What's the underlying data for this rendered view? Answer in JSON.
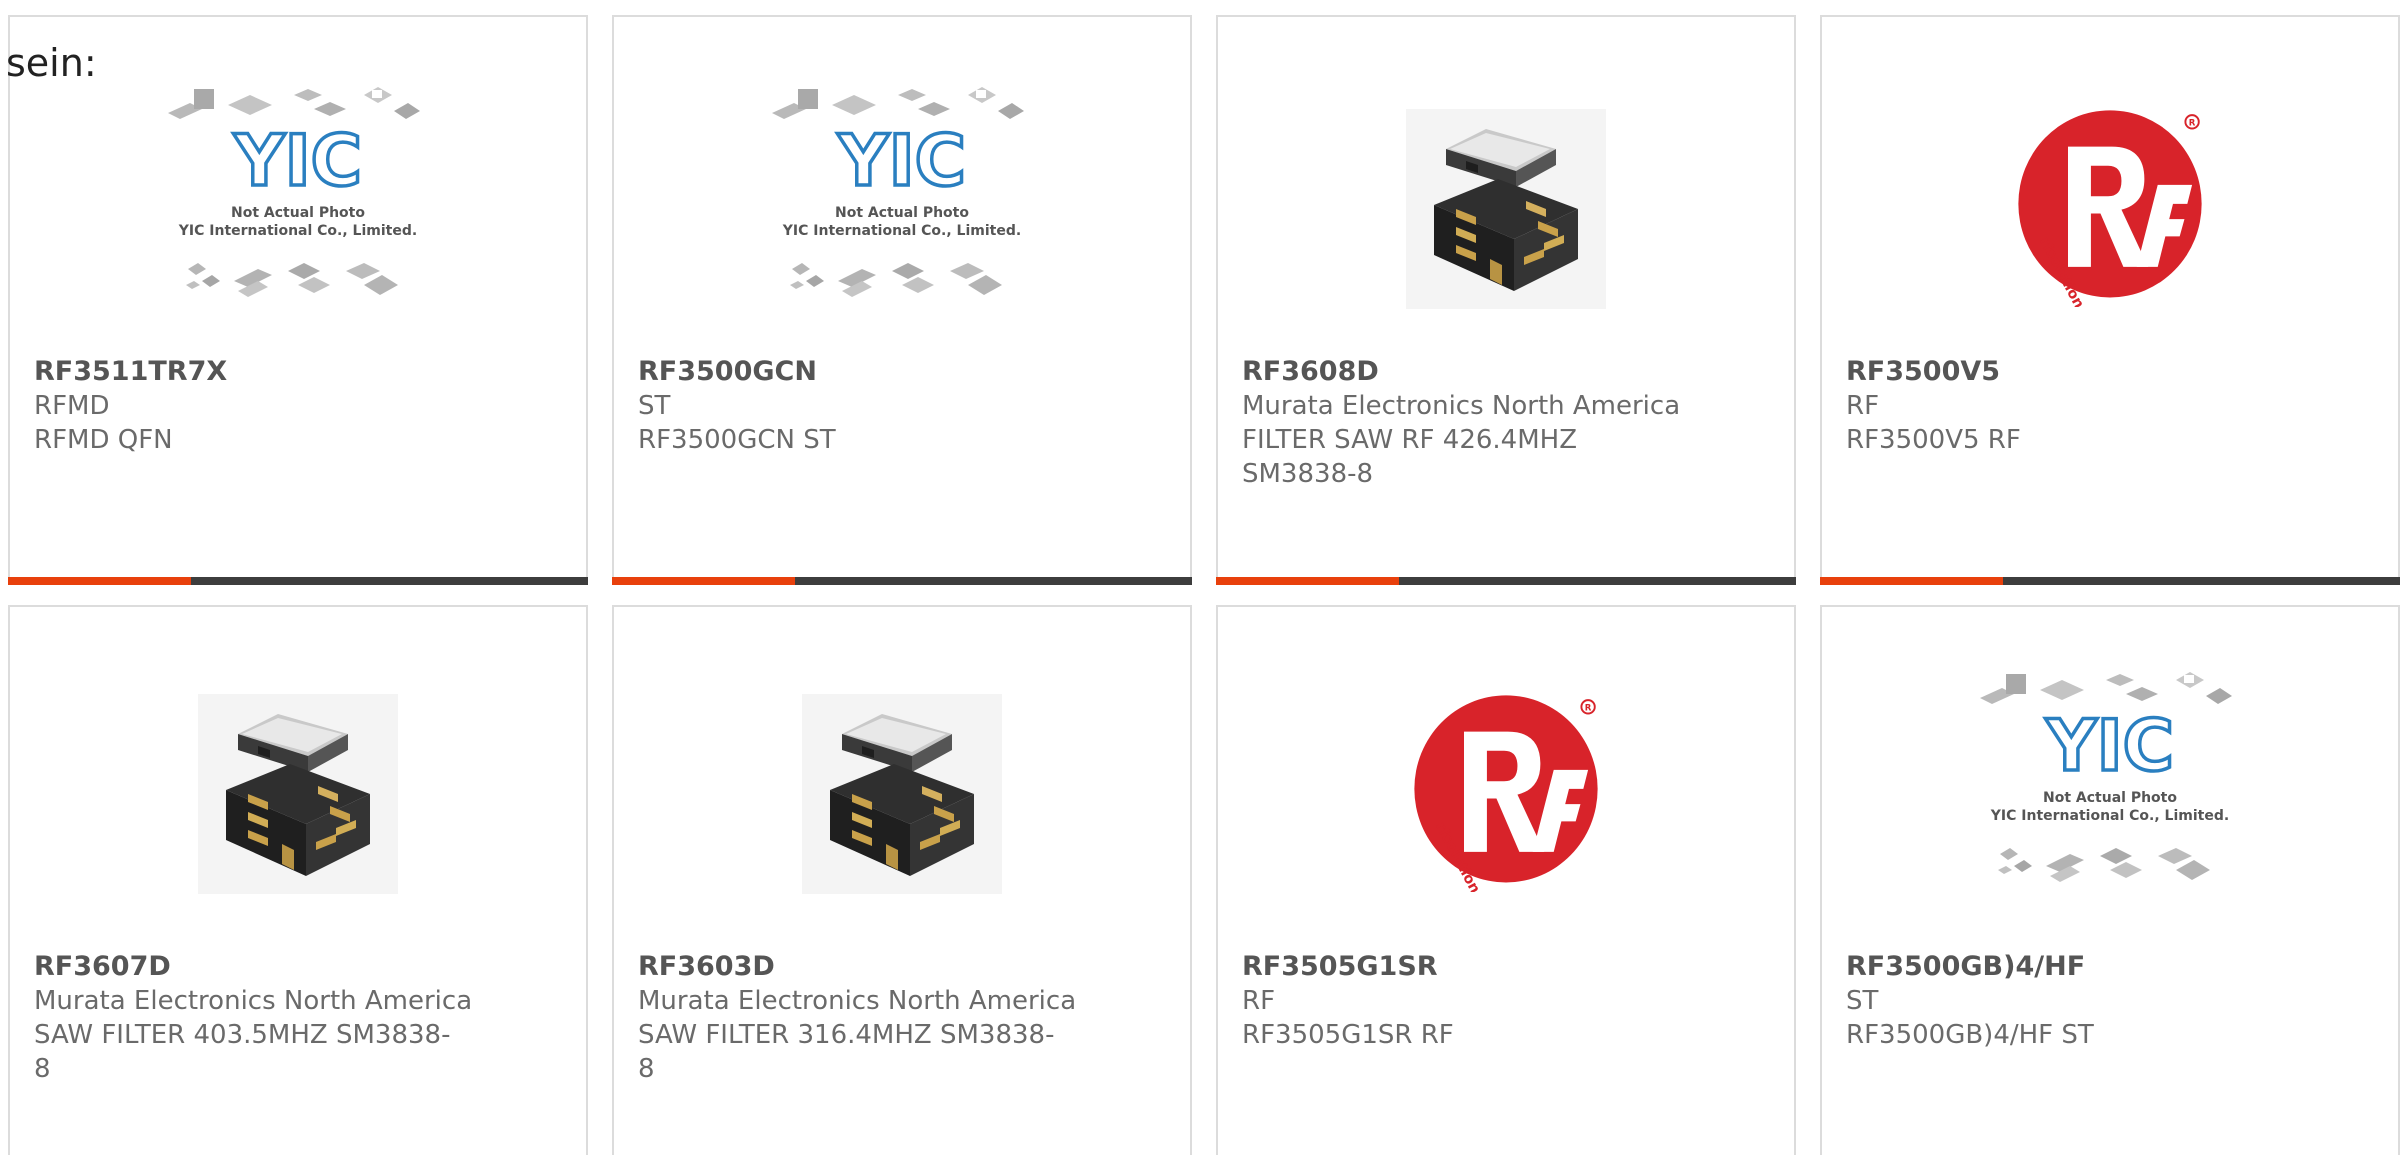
{
  "intro_text": "sein:",
  "colors": {
    "accent": "#e8400c",
    "bar": "#3d3d3d",
    "border": "#dcdcdc",
    "rf_red": "#d8232a",
    "yic_blue": "#2a7fc0"
  },
  "placeholder_image": {
    "line1": "Not Actual Photo",
    "line2": "YIC International Co., Limited."
  },
  "products": [
    {
      "part": "RF3511TR7X",
      "manufacturer": "RFMD",
      "description": "RFMD QFN",
      "image": "yic-placeholder"
    },
    {
      "part": "RF3500GCN",
      "manufacturer": "ST",
      "description": "RF3500GCN ST",
      "image": "yic-placeholder"
    },
    {
      "part": "RF3608D",
      "manufacturer": "Murata Electronics North America",
      "description_lines": [
        "FILTER SAW RF 426.4MHZ",
        "SM3838-8"
      ],
      "image": "saw-filter-chip"
    },
    {
      "part": "RF3500V5",
      "manufacturer": "RF",
      "description": "RF3500V5 RF",
      "image": "rf-solutions-logo"
    },
    {
      "part": "RF3607D",
      "manufacturer": "Murata Electronics North America",
      "description_lines": [
        "SAW FILTER 403.5MHZ SM3838-",
        "8"
      ],
      "image": "saw-filter-chip"
    },
    {
      "part": "RF3603D",
      "manufacturer": "Murata Electronics North America",
      "description_lines": [
        "SAW FILTER 316.4MHZ SM3838-",
        "8"
      ],
      "image": "saw-filter-chip"
    },
    {
      "part": "RF3505G1SR",
      "manufacturer": "RF",
      "description": "RF3505G1SR RF",
      "image": "rf-solutions-logo"
    },
    {
      "part": "RF3500GB)4/HF",
      "manufacturer": "ST",
      "description": "RF3500GB)4/HF ST",
      "image": "yic-placeholder"
    }
  ]
}
